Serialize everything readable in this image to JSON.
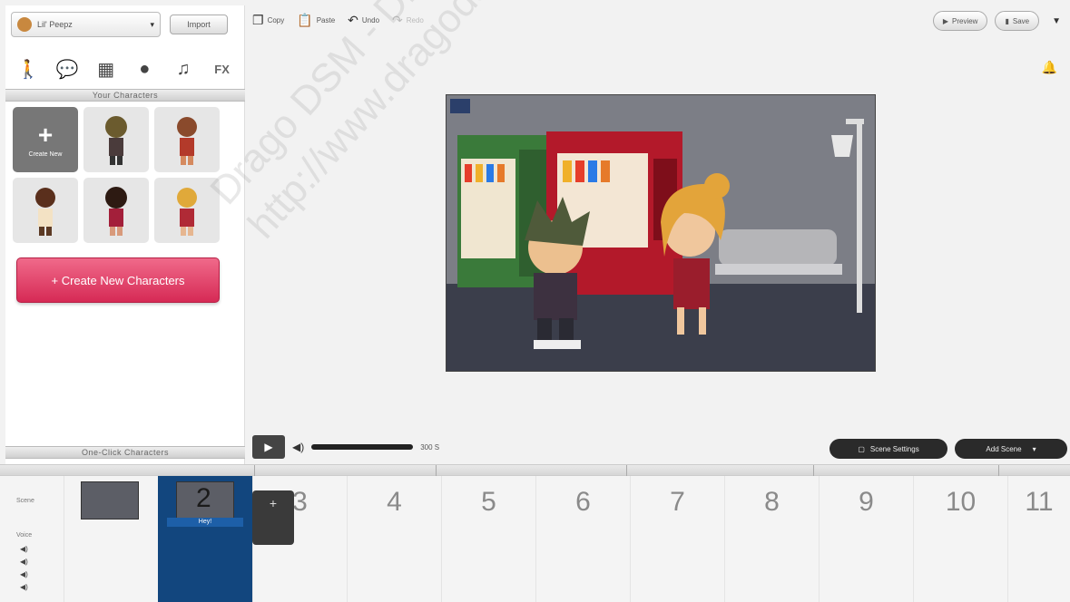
{
  "theme": {
    "name": "Lil' Peepz",
    "import_label": "Import"
  },
  "category_tabs": [
    {
      "icon": "character-icon"
    },
    {
      "icon": "speech-bubble-icon"
    },
    {
      "icon": "background-icon"
    },
    {
      "icon": "prop-icon"
    },
    {
      "icon": "music-icon"
    },
    {
      "icon": "fx-icon",
      "label": "FX"
    }
  ],
  "your_characters": {
    "header": "Your Characters",
    "create_tile_label": "Create New",
    "create_button_label": "+ Create New Characters"
  },
  "oneclick_header": "One-Click Characters",
  "toolbar": {
    "copy": "Copy",
    "paste": "Paste",
    "undo": "Undo",
    "redo": "Redo"
  },
  "top_right": {
    "preview": "Preview",
    "save": "Save"
  },
  "progress": {
    "time": "300 S",
    "fraction": 1.0
  },
  "scene_settings_label": "Scene Settings",
  "add_scene_label": "Add Scene",
  "timeline": {
    "scene_label": "Scene",
    "voice_label": "Voice",
    "scene_2_name": "Hey!",
    "scene_numbers": [
      "2",
      "3",
      "4",
      "5",
      "6",
      "7",
      "8",
      "9",
      "10",
      "11"
    ]
  },
  "watermark": {
    "line1": "Drago DSM - Distribuidora",
    "line2": "http://www.dragodsm.com.ar"
  },
  "colors": {
    "accent": "#d62a55",
    "timeline_selected": "#12467e"
  }
}
